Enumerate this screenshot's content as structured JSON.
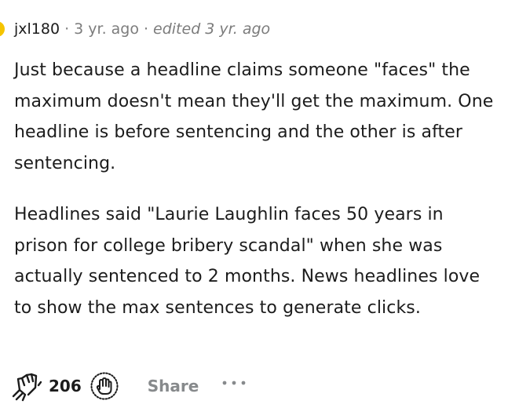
{
  "comment": {
    "author": "jxl180",
    "separator": "·",
    "time": "3 yr. ago",
    "edited": "edited 3 yr. ago",
    "paragraphs": [
      "Just because a headline claims someone \"faces\" the maximum doesn't mean they'll get the maximum. One headline is before sentencing and the other is after sentencing.",
      "Headlines said \"Laurie Laughlin faces 50 years in prison for college bribery scandal\" when she was actually sentenced to 2 months. News headlines love to show the max sentences to generate clicks."
    ],
    "score": "206",
    "share_label": "Share",
    "more_label": "•••"
  },
  "icons": {
    "upvote": "upvote-hands-icon",
    "downvote": "downvote-hand-icon",
    "more": "more-options-icon"
  },
  "colors": {
    "text": "#1c1c1c",
    "meta": "#7c7c7c",
    "action": "#878a8c",
    "avatar": "#f5c400"
  }
}
